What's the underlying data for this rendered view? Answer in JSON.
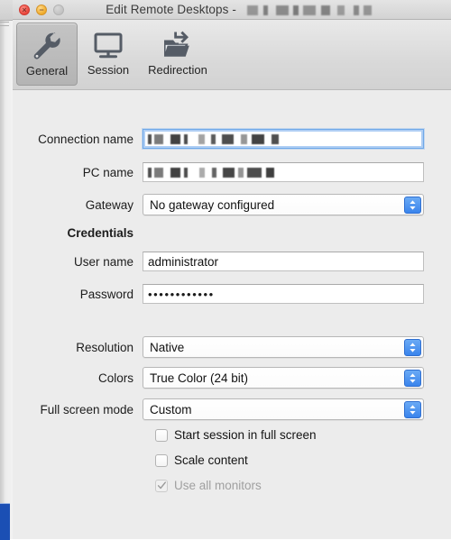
{
  "window": {
    "title_prefix": "Edit Remote Desktops - ",
    "title_redacted_note": "redacted",
    "traffic_lights": {
      "close_glyph": "×",
      "minimize_glyph": "−",
      "zoom_glyph": ""
    }
  },
  "toolbar": {
    "tabs": [
      {
        "label": "General",
        "icon": "wrench-icon",
        "selected": true
      },
      {
        "label": "Session",
        "icon": "monitor-icon",
        "selected": false
      },
      {
        "label": "Redirection",
        "icon": "folder-arrow-icon",
        "selected": false
      }
    ]
  },
  "form": {
    "connection_name": {
      "label": "Connection name",
      "value": "",
      "redacted": true,
      "focused": true
    },
    "pc_name": {
      "label": "PC name",
      "value": "",
      "redacted": true,
      "focused": false
    },
    "gateway": {
      "label": "Gateway",
      "value": "No gateway configured"
    },
    "credentials_heading": "Credentials",
    "user_name": {
      "label": "User name",
      "value": "administrator"
    },
    "password": {
      "label": "Password",
      "value": "••••••••••••"
    },
    "resolution": {
      "label": "Resolution",
      "value": "Native"
    },
    "colors": {
      "label": "Colors",
      "value": "True Color (24 bit)"
    },
    "full_screen_mode": {
      "label": "Full screen mode",
      "value": "Custom"
    },
    "checkboxes": [
      {
        "label": "Start session in full screen",
        "checked": false,
        "disabled": false
      },
      {
        "label": "Scale content",
        "checked": false,
        "disabled": false
      },
      {
        "label": "Use all monitors",
        "checked": true,
        "disabled": true
      }
    ]
  },
  "colors": {
    "accent_blue": "#3a84ec",
    "window_bg": "#ececec",
    "titlebar_bg": "#d9d9d9",
    "close_red": "#e8463c",
    "minimize_yellow": "#efab2a",
    "zoom_gray": "#c2c2c2",
    "selection_blue": "#1b4fb4"
  }
}
